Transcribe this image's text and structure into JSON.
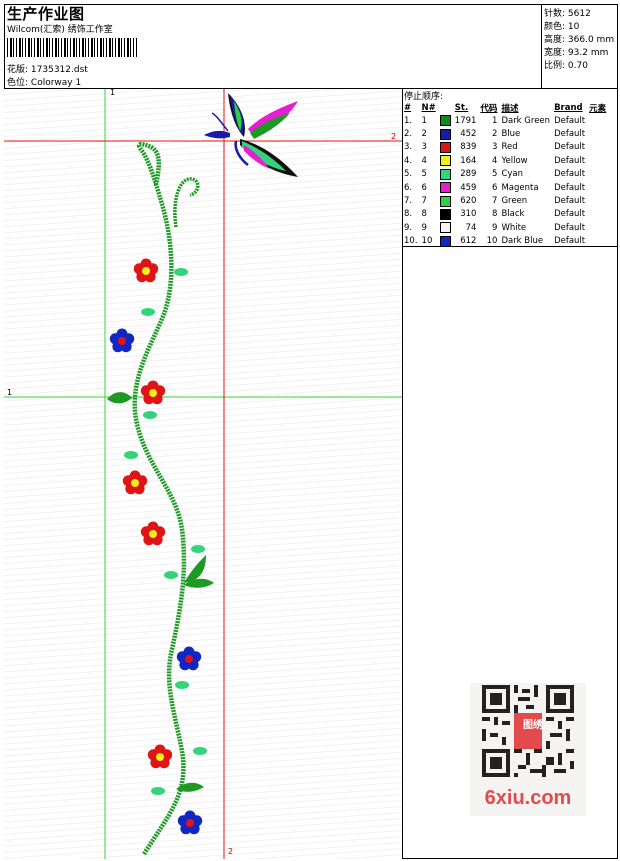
{
  "header": {
    "title": "生产作业图",
    "studio": "Wilcom(汇索) 绣饰工作室",
    "design_label": "花版:",
    "design_value": "1735312.dst",
    "colorway_label": "色位:",
    "colorway_value": "Colorway 1"
  },
  "stats": {
    "stitches_label": "针数:",
    "stitches_value": "5612",
    "colors_label": "颜色:",
    "colors_value": "10",
    "height_label": "高度:",
    "height_value": "366.0 mm",
    "width_label": "宽度:",
    "width_value": "93.2 mm",
    "scale_label": "比例:",
    "scale_value": "0.70"
  },
  "stop_sequence": {
    "heading": "停止顺序:",
    "columns": [
      "#",
      "N#",
      "St.",
      "代码",
      "描述",
      "Brand",
      "元素"
    ],
    "rows": [
      {
        "idx": "1.",
        "n": "1",
        "color": "#118a1e",
        "st": "1791",
        "code": "1",
        "desc": "Dark Green",
        "brand": "Default"
      },
      {
        "idx": "2.",
        "n": "2",
        "color": "#1a1aa8",
        "st": "452",
        "code": "2",
        "desc": "Blue",
        "brand": "Default"
      },
      {
        "idx": "3.",
        "n": "3",
        "color": "#e01414",
        "st": "839",
        "code": "3",
        "desc": "Red",
        "brand": "Default"
      },
      {
        "idx": "4.",
        "n": "4",
        "color": "#f2ef1a",
        "st": "164",
        "code": "4",
        "desc": "Yellow",
        "brand": "Default"
      },
      {
        "idx": "5.",
        "n": "5",
        "color": "#33d47a",
        "st": "289",
        "code": "5",
        "desc": "Cyan",
        "brand": "Default"
      },
      {
        "idx": "6.",
        "n": "6",
        "color": "#e61ed2",
        "st": "459",
        "code": "6",
        "desc": "Magenta",
        "brand": "Default"
      },
      {
        "idx": "7.",
        "n": "7",
        "color": "#2ad43a",
        "st": "620",
        "code": "7",
        "desc": "Green",
        "brand": "Default"
      },
      {
        "idx": "8.",
        "n": "8",
        "color": "#000000",
        "st": "310",
        "code": "8",
        "desc": "Black",
        "brand": "Default"
      },
      {
        "idx": "9.",
        "n": "9",
        "color": "#f4f4f4",
        "st": "74",
        "code": "9",
        "desc": "White",
        "brand": "Default"
      },
      {
        "idx": "10.",
        "n": "10",
        "color": "#1027c4",
        "st": "612",
        "code": "10",
        "desc": "Dark Blue",
        "brand": "Default"
      }
    ]
  },
  "canvas": {
    "axis_v1": "1",
    "axis_h1": "1",
    "axis_h2": "2",
    "axis_v2": "2"
  },
  "watermark": {
    "text": "6xiu.com",
    "seal": "图绣"
  }
}
